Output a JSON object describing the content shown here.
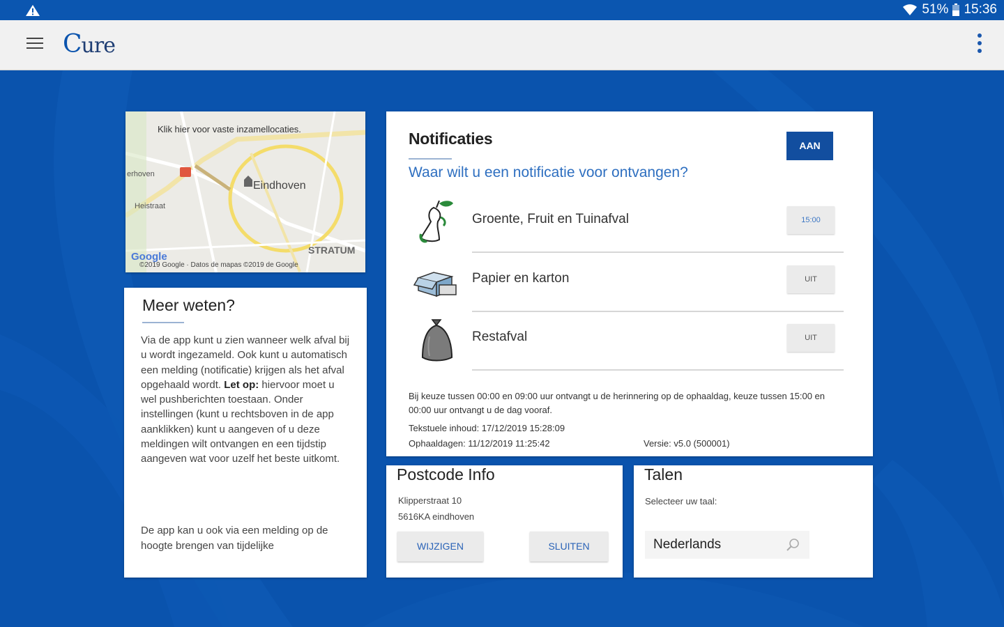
{
  "status_bar": {
    "battery": "51%",
    "time": "15:36"
  },
  "app_bar": {
    "logo_text": "ure",
    "logo_letter": "C"
  },
  "map": {
    "caption": "Klik hier voor vaste inzamellocaties.",
    "city": "Eindhoven",
    "label_west": "erhoven",
    "label_heistraat": "Heistraat",
    "label_stratum": "STRATUM",
    "google_logo": "Google",
    "copyright": "©2019 Google · Datos de mapas ©2019 de Google"
  },
  "info": {
    "title": "Meer weten?",
    "p1_before": "Via de app kunt u zien wanneer welk afval bij u wordt ingezameld. Ook kunt u automatisch een melding (notificatie) krijgen als het afval opgehaald wordt. ",
    "p1_bold": "Let op:",
    "p1_after": " hiervoor moet u wel pushberichten toestaan. Onder instellingen (kunt u rechtsboven in de app aanklikken) kunt u aangeven of u deze meldingen wilt ontvangen en een tijdstip aangeven wat voor uzelf het beste uitkomt.",
    "p2": "De app kan u ook via een melding op de hoogte brengen van tijdelijke"
  },
  "notificaties": {
    "title": "Notificaties",
    "toggle_label": "AAN",
    "question": "Waar wilt u een notificatie voor ontvangen?",
    "items": [
      {
        "label": "Groente, Fruit en Tuinafval",
        "value": "15:00",
        "icon": "apple-core-icon"
      },
      {
        "label": "Papier en karton",
        "value": "UIT",
        "icon": "paper-box-icon"
      },
      {
        "label": "Restafval",
        "value": "UIT",
        "icon": "trash-bag-icon"
      }
    ],
    "note": "Bij keuze tussen 00:00 en 09:00 uur ontvangt u de herinnering op de ophaaldag, keuze tussen 15:00 en 00:00 uur ontvangt u de dag vooraf.",
    "text_content": "Tekstuele inhoud: 17/12/2019 15:28:09",
    "pickup_days": "Ophaaldagen: 11/12/2019 11:25:42",
    "version": "Versie: v5.0 (500001)"
  },
  "postcode": {
    "title": "Postcode Info",
    "street": "Klipperstraat 10",
    "city": "5616KA eindhoven",
    "edit_label": "WIJZIGEN",
    "close_label": "SLUITEN"
  },
  "talen": {
    "title": "Talen",
    "prompt": "Selecteer uw taal:",
    "selected": "Nederlands"
  },
  "colors": {
    "background": "#0a53ad",
    "accent": "#124e9f",
    "link": "#2e6fc0"
  }
}
